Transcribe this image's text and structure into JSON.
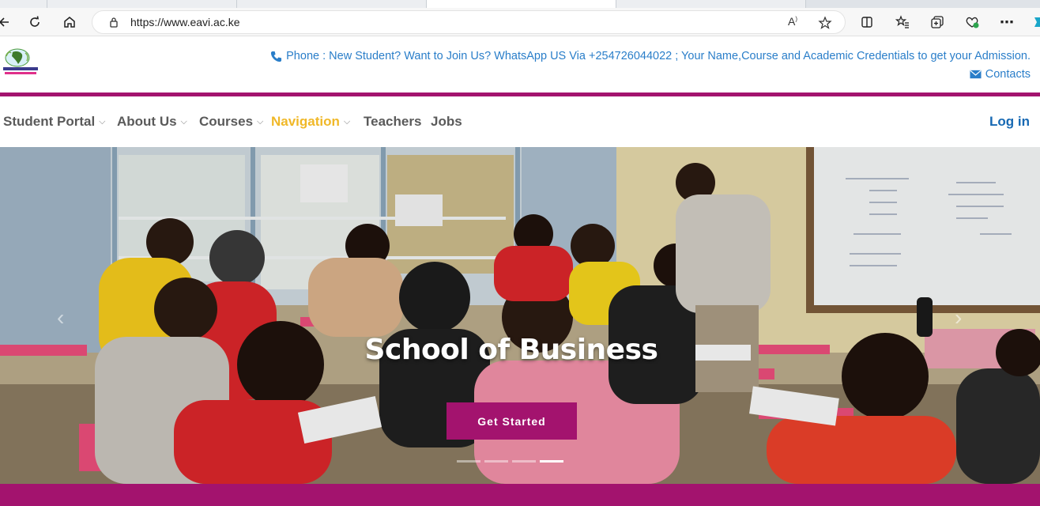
{
  "browser": {
    "url": "https://www.eavi.ac.ke",
    "icons": [
      "back-icon",
      "refresh-icon",
      "home-icon",
      "lock-icon",
      "read-aloud-icon",
      "favorite-icon",
      "split-screen-icon",
      "favorites-icon",
      "collections-icon",
      "performance-icon",
      "more-icon",
      "copilot-icon"
    ]
  },
  "header": {
    "phone_text": "Phone : New Student? Want to Join Us? WhatsApp US Via +254726044022 ; Your Name,Course and Academic Credentials to get your Admission.",
    "contacts_text": "Contacts",
    "accent_color": "#2a7ec9"
  },
  "nav": {
    "items": [
      {
        "label": "Student Portal",
        "dropdown": true
      },
      {
        "label": "About Us",
        "dropdown": true
      },
      {
        "label": "Courses",
        "dropdown": true
      },
      {
        "label": "Navigation",
        "dropdown": true,
        "active": true
      },
      {
        "label": "Teachers",
        "dropdown": false
      },
      {
        "label": "Jobs",
        "dropdown": false
      }
    ],
    "login": "Log in"
  },
  "hero": {
    "title": "School of Business",
    "cta": "Get Started",
    "slide_count": 4,
    "active_slide": 4
  },
  "colors": {
    "brand": "#a3136e",
    "active_nav": "#f0b828",
    "login": "#1769b3"
  }
}
